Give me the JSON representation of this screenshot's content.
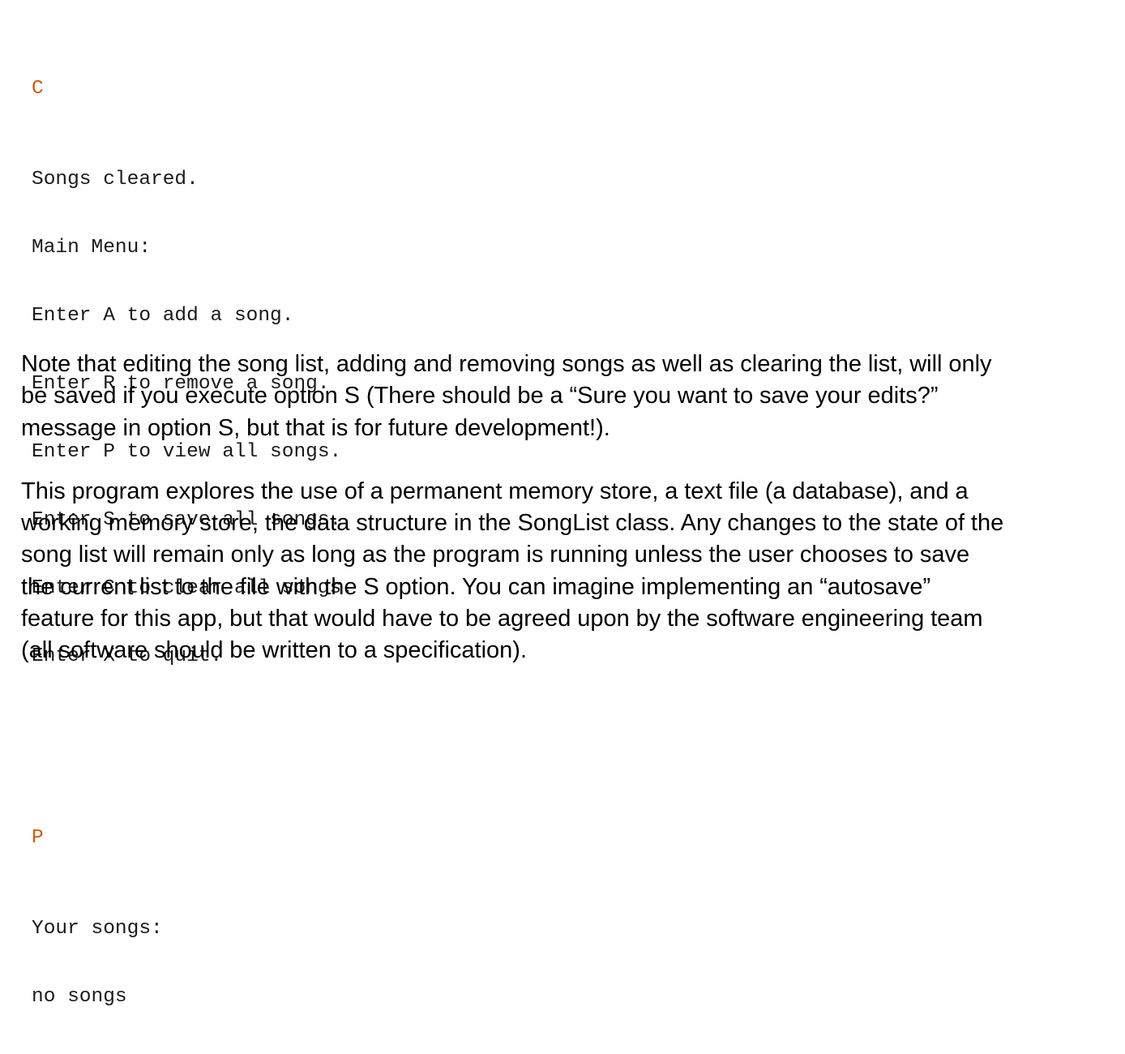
{
  "document": {
    "background_color": "#ffffff",
    "text_color": "#000000",
    "input_echo_color": "#cc5a14"
  },
  "console": {
    "label": "program console transcript",
    "sessions": [
      {
        "input": "C",
        "output": [
          "Songs cleared.",
          "Main Menu:",
          "Enter A to add a song.",
          "Enter R to remove a song.",
          "Enter P to view all songs.",
          "Enter S to save all songs.",
          "Enter C to clear all songs.",
          "Enter X to quit."
        ]
      },
      {
        "input": "P",
        "output": [
          "Your songs:",
          "no songs"
        ]
      }
    ]
  },
  "body": {
    "paragraphs": [
      "Note that editing the song list, adding and removing songs as well as clearing the list, will only be saved if you execute option S (There should be a “Sure you want to save your edits?” message in option S, but that is for future development!).",
      "This program explores the use of a permanent memory store, a text file (a database), and a working memory store, the data structure in the SongList class. Any changes to the state of the song list will remain only as long as the program is running unless the user chooses to save the current list to the file with the S option. You can imagine implementing an “autosave” feature for this app, but that would have to be agreed upon by the software engineering team (all software should be written to a specification)."
    ]
  }
}
